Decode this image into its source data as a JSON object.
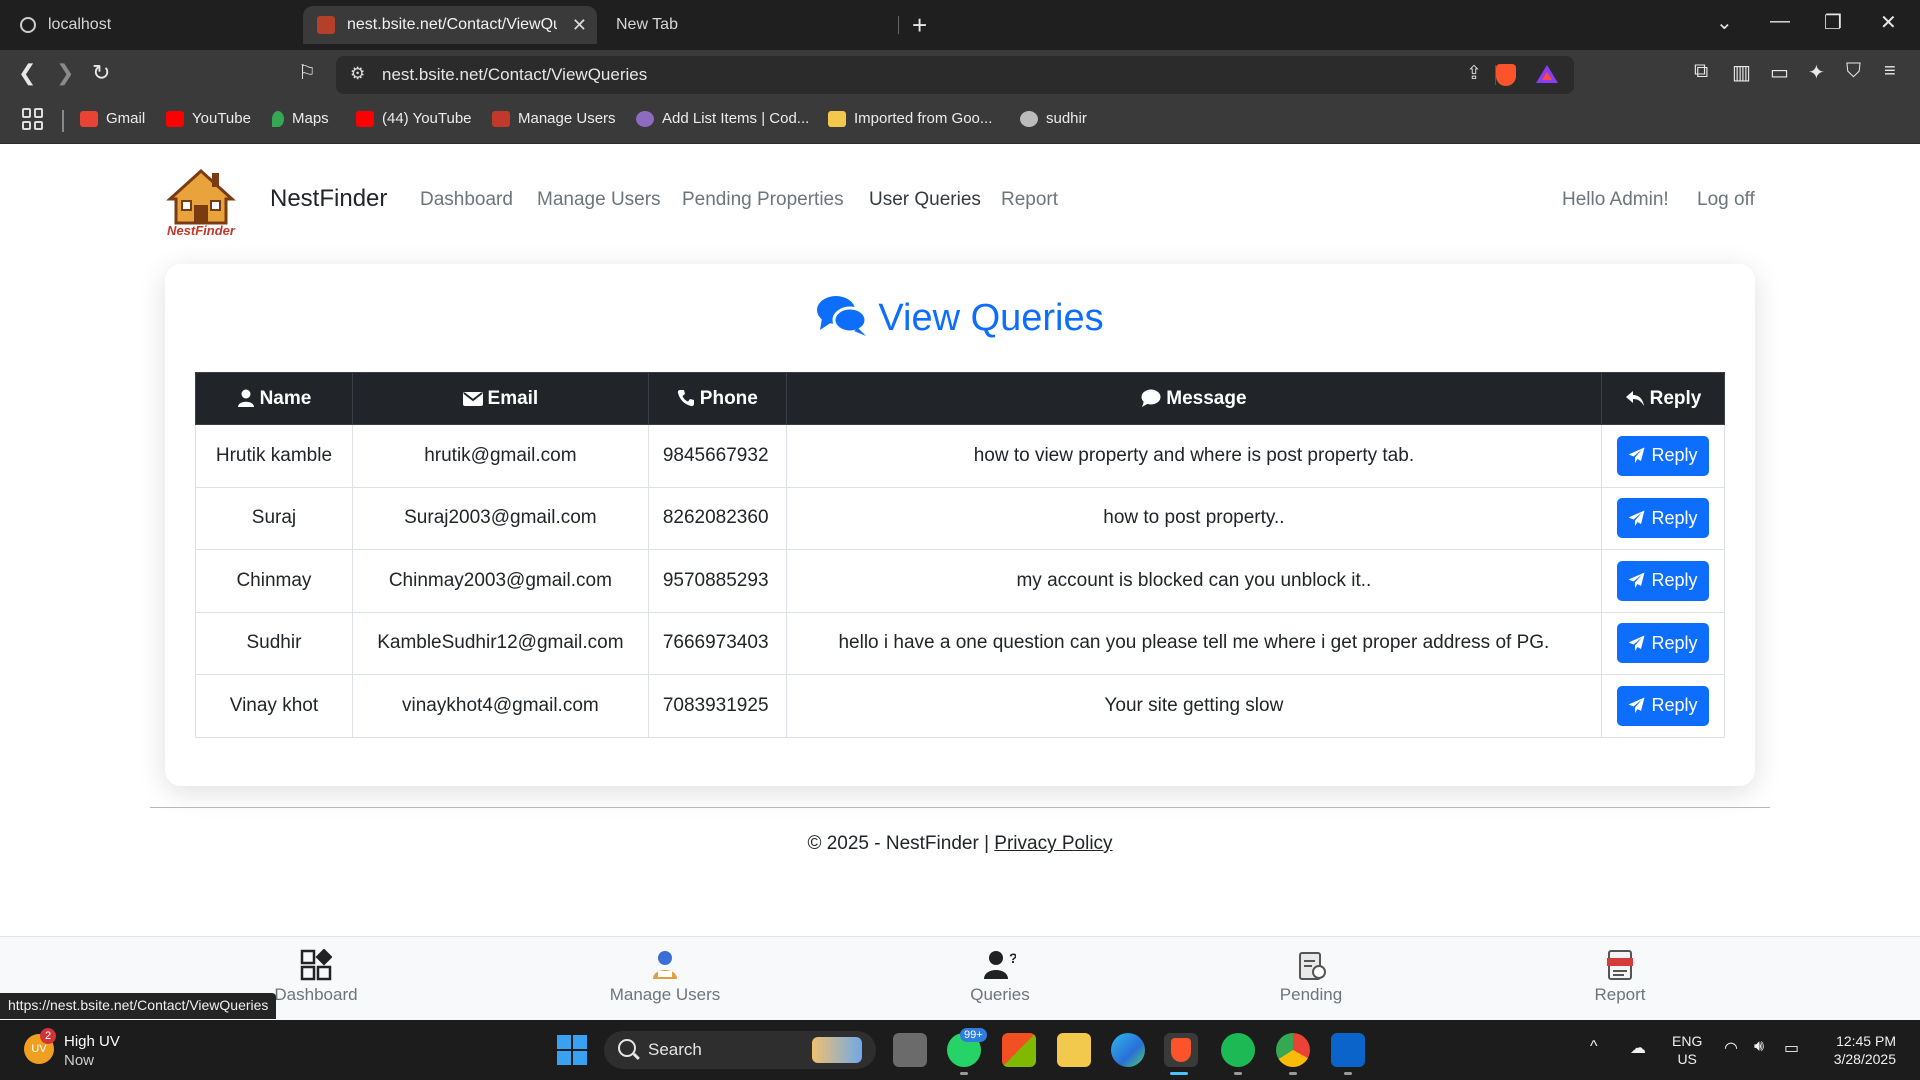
{
  "browser": {
    "tabs": [
      {
        "title": "localhost",
        "active": false
      },
      {
        "title": "nest.bsite.net/Contact/ViewQue",
        "active": true
      },
      {
        "title": "New Tab",
        "active": false
      }
    ],
    "url": "nest.bsite.net/Contact/ViewQueries",
    "bookmarks": [
      {
        "label": "Gmail",
        "color": "#ea4335"
      },
      {
        "label": "YouTube",
        "color": "#ff0000"
      },
      {
        "label": "Maps",
        "color": "#34a853"
      },
      {
        "label": "(44) YouTube",
        "color": "#ff0000"
      },
      {
        "label": "Manage Users",
        "color": "#c0392b"
      },
      {
        "label": "Add List Items | Cod...",
        "color": "#8e6bbf"
      },
      {
        "label": "Imported from Goo...",
        "color": "#f2c94c"
      },
      {
        "label": "sudhir",
        "color": "#bbbbbb"
      }
    ],
    "status_url": "https://nest.bsite.net/Contact/ViewQueries"
  },
  "nav": {
    "brand": "NestFinder",
    "logo_text": "NestFinder",
    "links": [
      "Dashboard",
      "Manage Users",
      "Pending Properties",
      "User Queries",
      "Report"
    ],
    "active_link": "User Queries",
    "greeting": "Hello Admin!",
    "logoff": "Log off"
  },
  "page": {
    "title": "View Queries",
    "columns": [
      "Name",
      "Email",
      "Phone",
      "Message",
      "Reply"
    ],
    "reply_label": "Reply",
    "rows": [
      {
        "name": "Hrutik kamble",
        "email": "hrutik@gmail.com",
        "phone": "9845667932",
        "message": "how to view property and where is post property tab."
      },
      {
        "name": "Suraj",
        "email": "Suraj2003@gmail.com",
        "phone": "8262082360",
        "message": "how to post property.."
      },
      {
        "name": "Chinmay",
        "email": "Chinmay2003@gmail.com",
        "phone": "9570885293",
        "message": "my account is blocked can you unblock it.."
      },
      {
        "name": "Sudhir",
        "email": "KambleSudhir12@gmail.com",
        "phone": "7666973403",
        "message": "hello i have a one question can you please tell me where i get proper address of PG."
      },
      {
        "name": "Vinay khot",
        "email": "vinaykhot4@gmail.com",
        "phone": "7083931925",
        "message": "Your site getting slow"
      }
    ]
  },
  "footer": {
    "copyright": "© 2025 - NestFinder | ",
    "privacy": "Privacy Policy"
  },
  "bottom_nav": [
    "Dashboard",
    "Manage Users",
    "Queries",
    "Pending",
    "Report"
  ],
  "taskbar": {
    "weather_title": "High UV",
    "weather_sub": "Now",
    "weather_badge": "2",
    "weather_icon_text": "UV",
    "search": "Search",
    "whatsapp_badge": "99+",
    "lang_top": "ENG",
    "lang_bottom": "US",
    "time": "12:45 PM",
    "date": "3/28/2025"
  },
  "colors": {
    "primary": "#0d6efd",
    "table_header": "#212529",
    "chrome_dark": "#1f1f1f"
  }
}
